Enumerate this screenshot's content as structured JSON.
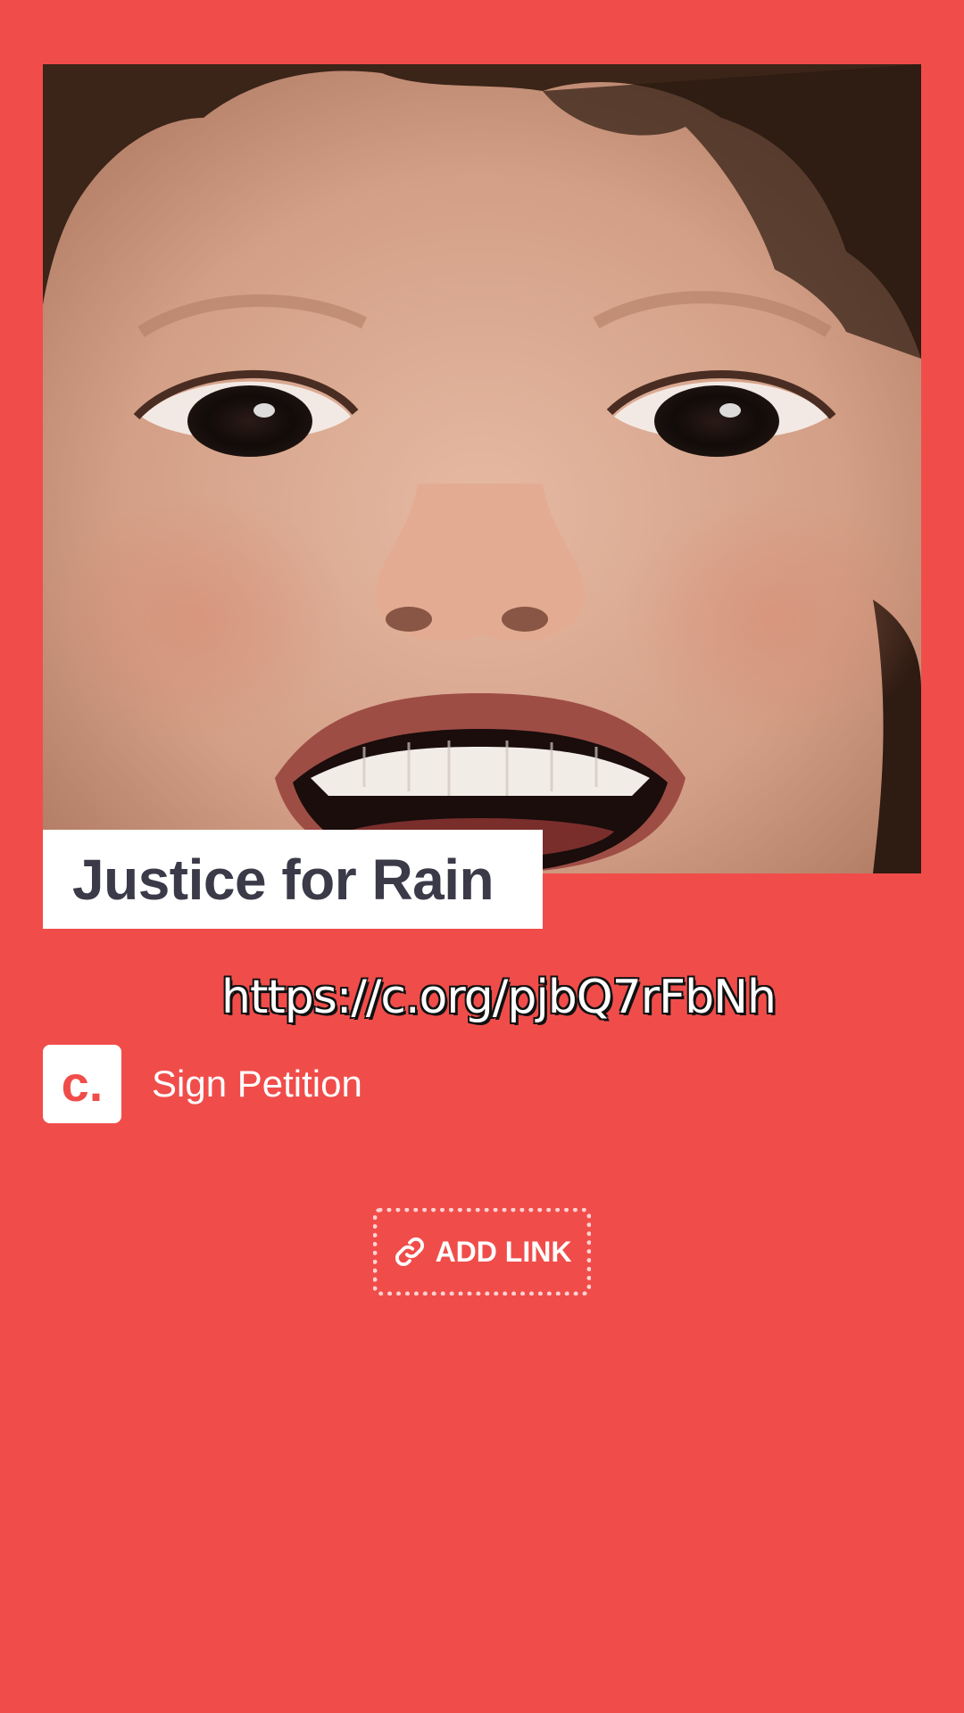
{
  "card": {
    "title": "Justice for Rain",
    "url": "https://c.org/pjbQ7rFbNh",
    "photo": "smiling child close-up face"
  },
  "sign_row": {
    "logo_text": "c.",
    "label": "Sign Petition"
  },
  "add_link": {
    "label": "ADD LINK",
    "icon": "link-icon"
  },
  "colors": {
    "background": "#f04d4a",
    "title_text": "#3a3a48",
    "white": "#ffffff"
  }
}
